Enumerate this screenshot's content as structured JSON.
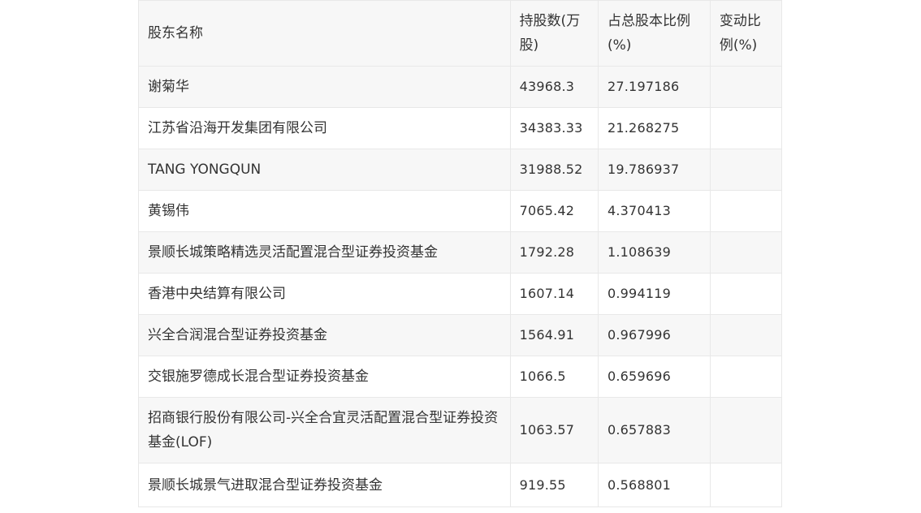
{
  "table": {
    "headers": {
      "name": "股东名称",
      "shares": "持股数(万股)",
      "percent": "占总股本比例(%)",
      "change": "变动比例(%)"
    },
    "rows": [
      {
        "name": "谢菊华",
        "shares": "43968.3",
        "percent": "27.197186",
        "change": ""
      },
      {
        "name": "江苏省沿海开发集团有限公司",
        "shares": "34383.33",
        "percent": "21.268275",
        "change": ""
      },
      {
        "name": "TANG YONGQUN",
        "shares": "31988.52",
        "percent": "19.786937",
        "change": ""
      },
      {
        "name": "黄锡伟",
        "shares": "7065.42",
        "percent": "4.370413",
        "change": ""
      },
      {
        "name": "景顺长城策略精选灵活配置混合型证券投资基金",
        "shares": "1792.28",
        "percent": "1.108639",
        "change": ""
      },
      {
        "name": "香港中央结算有限公司",
        "shares": "1607.14",
        "percent": "0.994119",
        "change": ""
      },
      {
        "name": "兴全合润混合型证券投资基金",
        "shares": "1564.91",
        "percent": "0.967996",
        "change": ""
      },
      {
        "name": "交银施罗德成长混合型证券投资基金",
        "shares": "1066.5",
        "percent": "0.659696",
        "change": ""
      },
      {
        "name": "招商银行股份有限公司-兴全合宜灵活配置混合型证券投资基金(LOF)",
        "shares": "1063.57",
        "percent": "0.657883",
        "change": ""
      },
      {
        "name": "景顺长城景气进取混合型证券投资基金",
        "shares": "919.55",
        "percent": "0.568801",
        "change": ""
      }
    ]
  }
}
